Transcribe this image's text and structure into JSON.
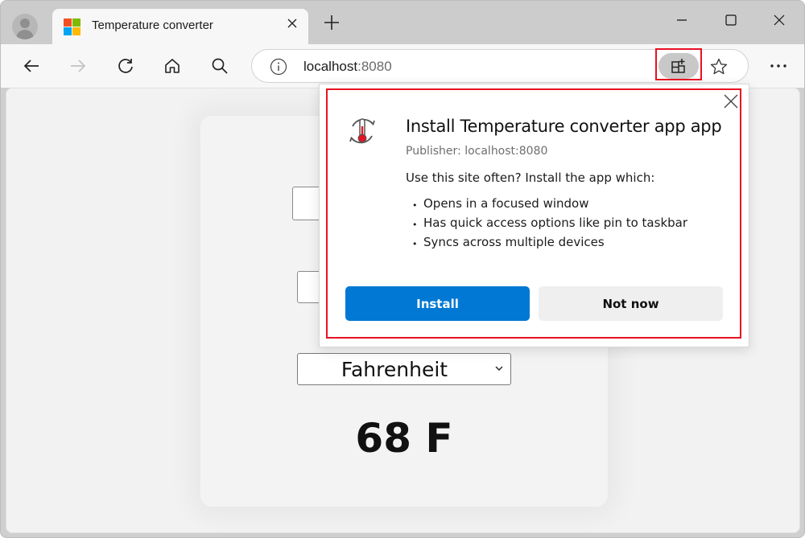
{
  "browser": {
    "tab": {
      "title": "Temperature converter",
      "favicon": "microsoft-logo-icon",
      "favicon_colors": [
        "#f25022",
        "#7fba00",
        "#00a4ef",
        "#ffb900"
      ]
    },
    "new_tab_label": "+",
    "address_bar": {
      "host": "localhost",
      "port": ":8080"
    },
    "toolbar_icons": [
      "back-icon",
      "forward-icon",
      "refresh-icon",
      "home-icon",
      "search-icon",
      "info-icon",
      "app-available-icon",
      "favorite-star-icon",
      "more-icon"
    ],
    "window_controls": [
      "minimize-icon",
      "maximize-icon",
      "close-icon"
    ]
  },
  "page": {
    "unit_select": {
      "selected": "Fahrenheit"
    },
    "result": "68 F"
  },
  "install_popup": {
    "title": "Install Temperature converter app app",
    "publisher": "Publisher: localhost:8080",
    "description": "Use this site often? Install the app which:",
    "features": [
      "Opens in a focused window",
      "Has quick access options like pin to taskbar",
      "Syncs across multiple devices"
    ],
    "install_label": "Install",
    "not_now_label": "Not now",
    "accent_color": "#0078d4",
    "highlight_color": "#e81123"
  }
}
